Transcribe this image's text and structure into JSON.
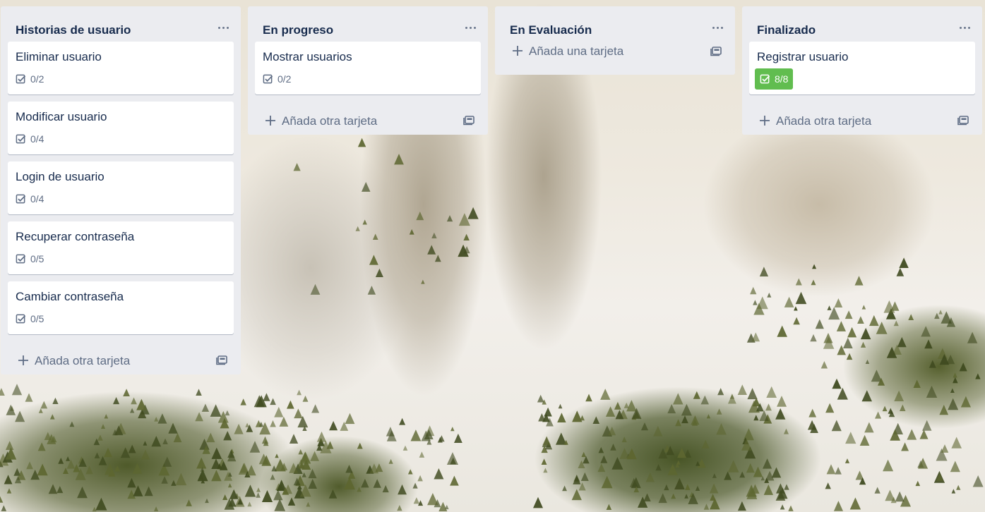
{
  "colors": {
    "list_background": "#ebecf0",
    "card_background": "#ffffff",
    "text_primary": "#172b4d",
    "text_muted": "#5e6c84",
    "checklist_complete": "#61bd4f"
  },
  "icons": {
    "list_menu": "ellipsis-icon",
    "checklist": "checkbox-icon",
    "add": "plus-icon",
    "template": "card-template-icon"
  },
  "lists": [
    {
      "title": "Historias de usuario",
      "cards": [
        {
          "title": "Eliminar usuario",
          "checklist": "0/2",
          "complete": false
        },
        {
          "title": "Modificar usuario",
          "checklist": "0/4",
          "complete": false
        },
        {
          "title": "Login de usuario",
          "checklist": "0/4",
          "complete": false
        },
        {
          "title": "Recuperar contraseña",
          "checklist": "0/5",
          "complete": false
        },
        {
          "title": "Cambiar contraseña",
          "checklist": "0/5",
          "complete": false
        }
      ],
      "add_label": "Añada otra tarjeta"
    },
    {
      "title": "En progreso",
      "cards": [
        {
          "title": "Mostrar usuarios",
          "checklist": "0/2",
          "complete": false
        }
      ],
      "add_label": "Añada otra tarjeta"
    },
    {
      "title": "En Evaluación",
      "cards": [],
      "add_label": "Añada una tarjeta"
    },
    {
      "title": "Finalizado",
      "cards": [
        {
          "title": "Registrar usuario",
          "checklist": "8/8",
          "complete": true
        }
      ],
      "add_label": "Añada otra tarjeta"
    }
  ]
}
